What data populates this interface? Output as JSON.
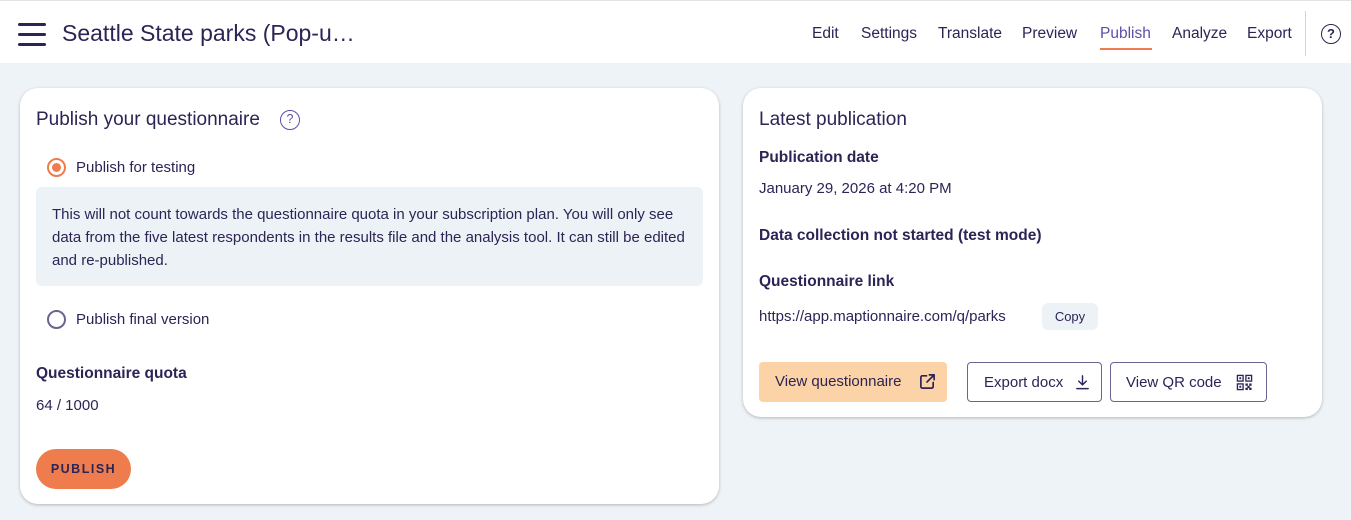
{
  "header": {
    "title": "Seattle State parks (Pop-u…",
    "nav": [
      "Edit",
      "Settings",
      "Translate",
      "Preview",
      "Publish",
      "Analyze",
      "Export"
    ],
    "active_nav": "Publish",
    "help_glyph": "?"
  },
  "publish_card": {
    "title": "Publish your questionnaire",
    "help_glyph": "?",
    "options": [
      {
        "label": "Publish for testing",
        "selected": true
      },
      {
        "label": "Publish final version",
        "selected": false
      }
    ],
    "testing_info": "This will not count towards the questionnaire quota in your subscription plan. You will only see data from the five latest respondents in the results file and the analysis tool. It can still be edited and re-published.",
    "quota_label": "Questionnaire quota",
    "quota_value": "64 / 1000",
    "publish_button": "PUBLISH"
  },
  "latest_card": {
    "title": "Latest publication",
    "date_label": "Publication date",
    "date_value": "January 29, 2026 at 4:20 PM",
    "status": "Data collection not started (test mode)",
    "link_label": "Questionnaire link",
    "link_value": "https://app.maptionnaire.com/q/parks",
    "copy_button": "Copy",
    "view_button": "View questionnaire",
    "export_button": "Export docx",
    "qr_button": "View QR code"
  },
  "colors": {
    "accent": "#ef7c4c",
    "text": "#2c2455",
    "primary_button": "#fbd3a6",
    "background": "#eef3f7"
  },
  "icons": [
    "menu-icon",
    "help-icon",
    "external-link-icon",
    "download-icon",
    "qr-code-icon"
  ]
}
